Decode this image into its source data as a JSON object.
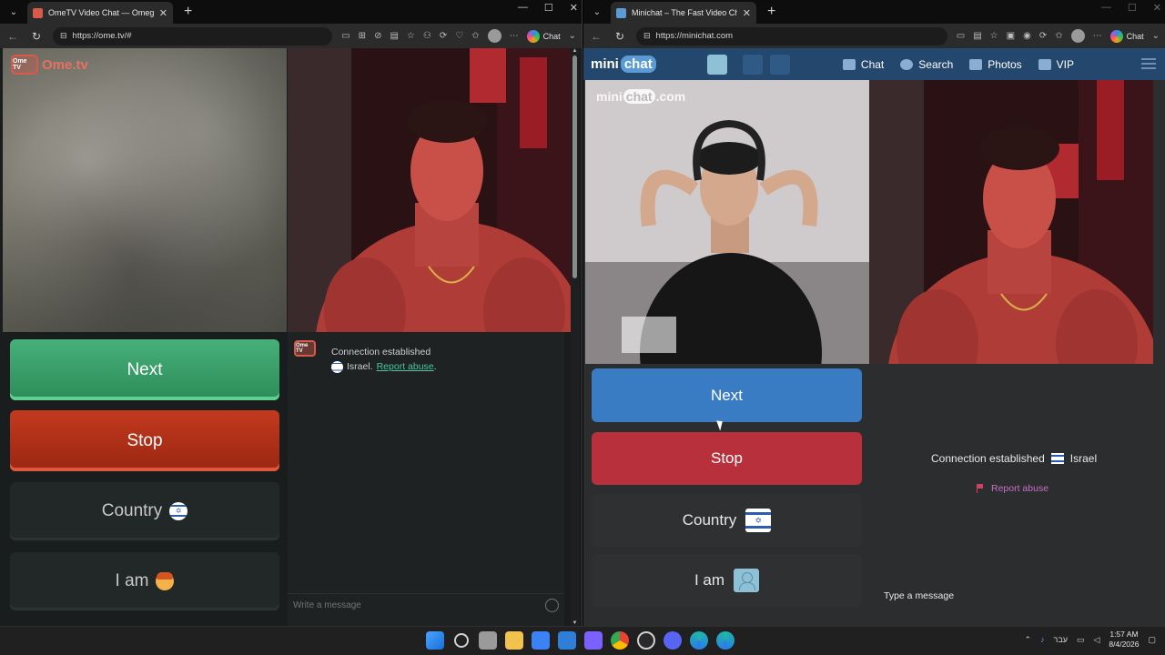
{
  "left_window": {
    "tab_title": "OmeTV Video Chat — Omegle",
    "url": "https://ome.tv/#",
    "copilot_label": "Chat",
    "logo_badge": "Ome TV",
    "logo_text": "Ome.tv",
    "buttons": {
      "next": "Next",
      "stop": "Stop",
      "country": "Country",
      "iam": "I am"
    },
    "chat": {
      "status": "Connection established",
      "country": "Israel.",
      "report": "Report abuse",
      "report_suffix": ".",
      "placeholder": "Write a message"
    }
  },
  "right_window": {
    "tab_title": "Minichat – The Fast Video Chat",
    "url": "https://minichat.com",
    "copilot_label": "Chat",
    "logo": {
      "part1": "mini",
      "part2": "chat"
    },
    "nav": {
      "chat": "Chat",
      "search": "Search",
      "photos": "Photos",
      "vip": "VIP"
    },
    "watermark": {
      "part1": "mini",
      "part2": "chat",
      "part3": ".com"
    },
    "buttons": {
      "next": "Next",
      "stop": "Stop",
      "country": "Country",
      "iam": "I am"
    },
    "chat": {
      "status": "Connection established",
      "country": "Israel",
      "report": "Report abuse",
      "placeholder": "Type a message"
    }
  },
  "taskbar": {
    "language": "עבר",
    "time": "1:57 AM",
    "date": "8/4/2026"
  },
  "colors": {
    "ome_next": "#3a9d6a",
    "ome_stop": "#b02f18",
    "mini_next": "#3a7cc3",
    "mini_stop": "#b8303c",
    "mini_header": "#24476e"
  }
}
